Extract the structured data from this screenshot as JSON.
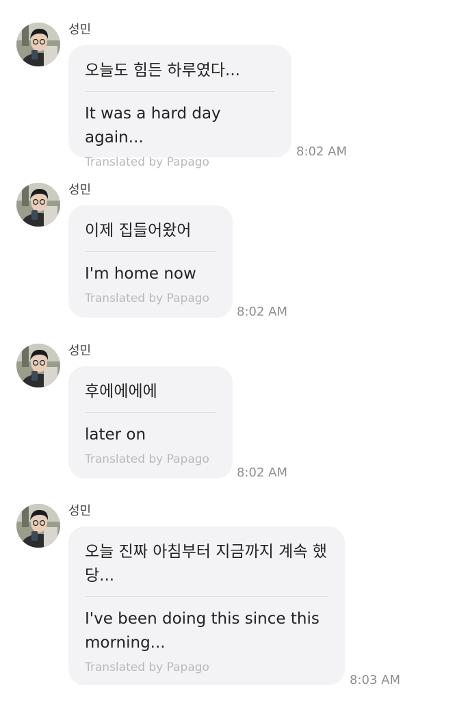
{
  "messages": [
    {
      "sender": "성민",
      "original": "오늘도 힘든 하루였다...",
      "translation": "It was a hard day again...",
      "credit": "Translated by Papago",
      "time": "8:02 AM"
    },
    {
      "sender": "성민",
      "original": "이제 집들어왔어",
      "translation": "I'm home now",
      "credit": "Translated by Papago",
      "time": "8:02 AM"
    },
    {
      "sender": "성민",
      "original": "후에에에에",
      "translation": "later on",
      "credit": "Translated by Papago",
      "time": "8:02 AM"
    },
    {
      "sender": "성민",
      "original": "오늘 진짜 아침부터 지금까지 계속 했당...",
      "translation": "I've been doing this since this morning...",
      "credit": "Translated by Papago",
      "time": "8:03 AM"
    }
  ],
  "colors": {
    "bubble": "#f3f3f5",
    "text": "#222222",
    "credit": "#b9b9bd",
    "time": "#8e8e93"
  }
}
